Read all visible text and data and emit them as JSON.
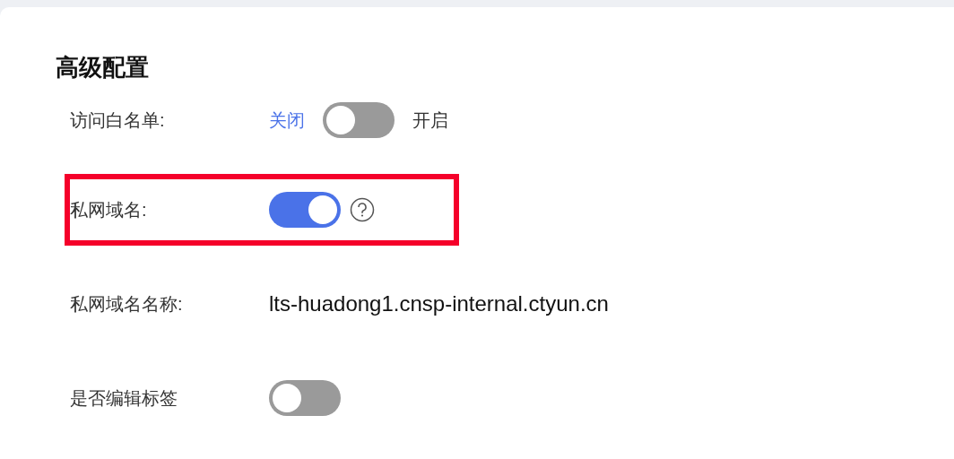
{
  "section": {
    "title": "高级配置"
  },
  "rows": [
    {
      "kind": "switch",
      "label": "访问白名单:",
      "off_label": "关闭",
      "on_label": "开启",
      "on": false,
      "highlighted": false
    },
    {
      "kind": "switch",
      "label": "私网域名:",
      "on": true,
      "help": true,
      "highlighted": true
    },
    {
      "kind": "text",
      "label": "私网域名名称:",
      "value": "lts-huadong1.cnsp-internal.ctyun.cn",
      "highlighted": false
    },
    {
      "kind": "switch",
      "label": "是否编辑标签",
      "on": false,
      "highlighted": false
    }
  ]
}
